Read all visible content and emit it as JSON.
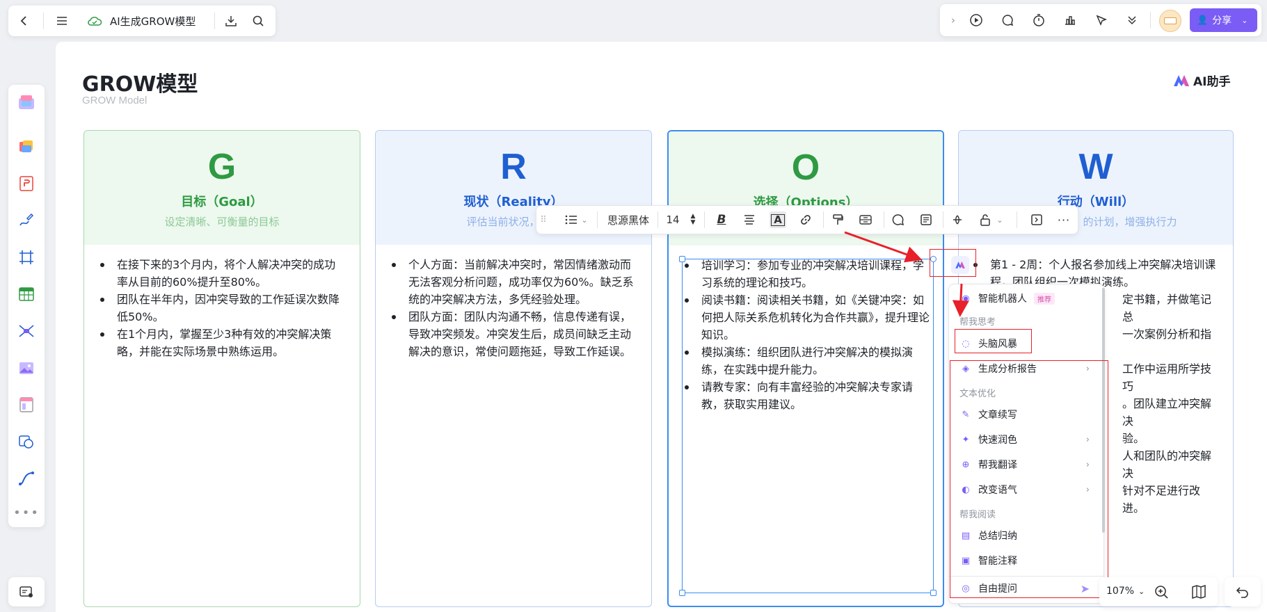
{
  "topbar": {
    "doc_title": "AI生成GROW模型",
    "share_label": "分享"
  },
  "board": {
    "title": "GROW模型",
    "subtitle": "GROW Model",
    "ai_assistant_label": "AI助手"
  },
  "columns": [
    {
      "letter": "G",
      "title": "目标（Goal）",
      "subtitle": "设定清晰、可衡量的目标",
      "items": [
        "在接下来的3个月内，将个人解决冲突的成功率从目前的60%提升至80%。",
        "团队在半年内，因冲突导致的工作延误次数降低50%。",
        "在1个月内，掌握至少3种有效的冲突解决策略，并能在实际场景中熟练运用。"
      ]
    },
    {
      "letter": "R",
      "title": "现状（Reality）",
      "subtitle": "评估当前状况，识别",
      "items": [
        "个人方面：当前解决冲突时，常因情绪激动而无法客观分析问题，成功率仅为60%。缺乏系统的冲突解决方法，多凭经验处理。",
        "团队方面：团队内沟通不畅，信息传递有误，导致冲突频发。冲突发生后，成员间缺乏主动解决的意识，常使问题拖延，导致工作延误。"
      ]
    },
    {
      "letter": "O",
      "title": "选择（Options）",
      "subtitle": "",
      "items": [
        "培训学习：参加专业的冲突解决培训课程，学习系统的理论和技巧。",
        "阅读书籍：阅读相关书籍，如《关键冲突：如何把人际关系危机转化为合作共赢》，提升理论知识。",
        "模拟演练：组织团队进行冲突解决的模拟演练，在实践中提升能力。",
        "请教专家：向有丰富经验的冲突解决专家请教，获取实用建议。"
      ]
    },
    {
      "letter": "W",
      "title": "行动（Will）",
      "subtitle": "的计划，增强执行力",
      "items": [
        "第1 - 2周：个人报名参加线上冲突解决培训课程，团队组织一次模拟演练。",
        "定书籍，并做笔记总",
        "一次案例分析和指",
        "工作中运用所学技巧",
        "。团队建立冲突解决",
        "验。",
        "人和团队的冲突解决",
        "针对不足进行改进。"
      ]
    }
  ],
  "format_toolbar": {
    "font_name": "思源黑体",
    "font_size": "14"
  },
  "ai_menu": {
    "top_item": "智能机器人",
    "top_badge": "推荐",
    "section_think": "帮我思考",
    "brainstorm": "头脑风暴",
    "analysis_report": "生成分析报告",
    "section_text": "文本优化",
    "continue_writing": "文章续写",
    "quick_polish": "快速润色",
    "translate": "帮我翻译",
    "change_tone": "改变语气",
    "section_read": "帮我阅读",
    "summarize": "总结归纳",
    "smart_annotate": "智能注释",
    "free_ask": "自由提问"
  },
  "zoom": {
    "value": "107%"
  },
  "colors": {
    "accent_purple": "#7b5cf5",
    "green": "#2e9a42",
    "blue": "#1f5fd1",
    "annotation_red": "#e8202a"
  }
}
